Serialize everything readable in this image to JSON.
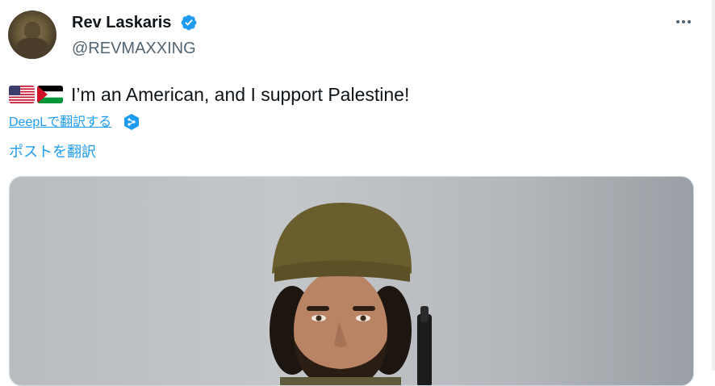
{
  "author": {
    "display_name": "Rev Laskaris",
    "handle": "@REVMAXXING",
    "verified": true,
    "verified_color": "#1d9bf0"
  },
  "tweet": {
    "flags": [
      "us-flag-emoji",
      "palestine-flag-emoji"
    ],
    "text": "I’m an American, and I support Palestine!",
    "deepl_translate_label": "DeepLで翻訳する",
    "translate_post_label": "ポストを翻訳"
  },
  "media": {
    "description_icon": "photo-of-man-in-olive-beanie-with-rifle"
  },
  "colors": {
    "link": "#1d9bf0",
    "secondary_text": "#536471",
    "primary_text": "#0f1419"
  }
}
